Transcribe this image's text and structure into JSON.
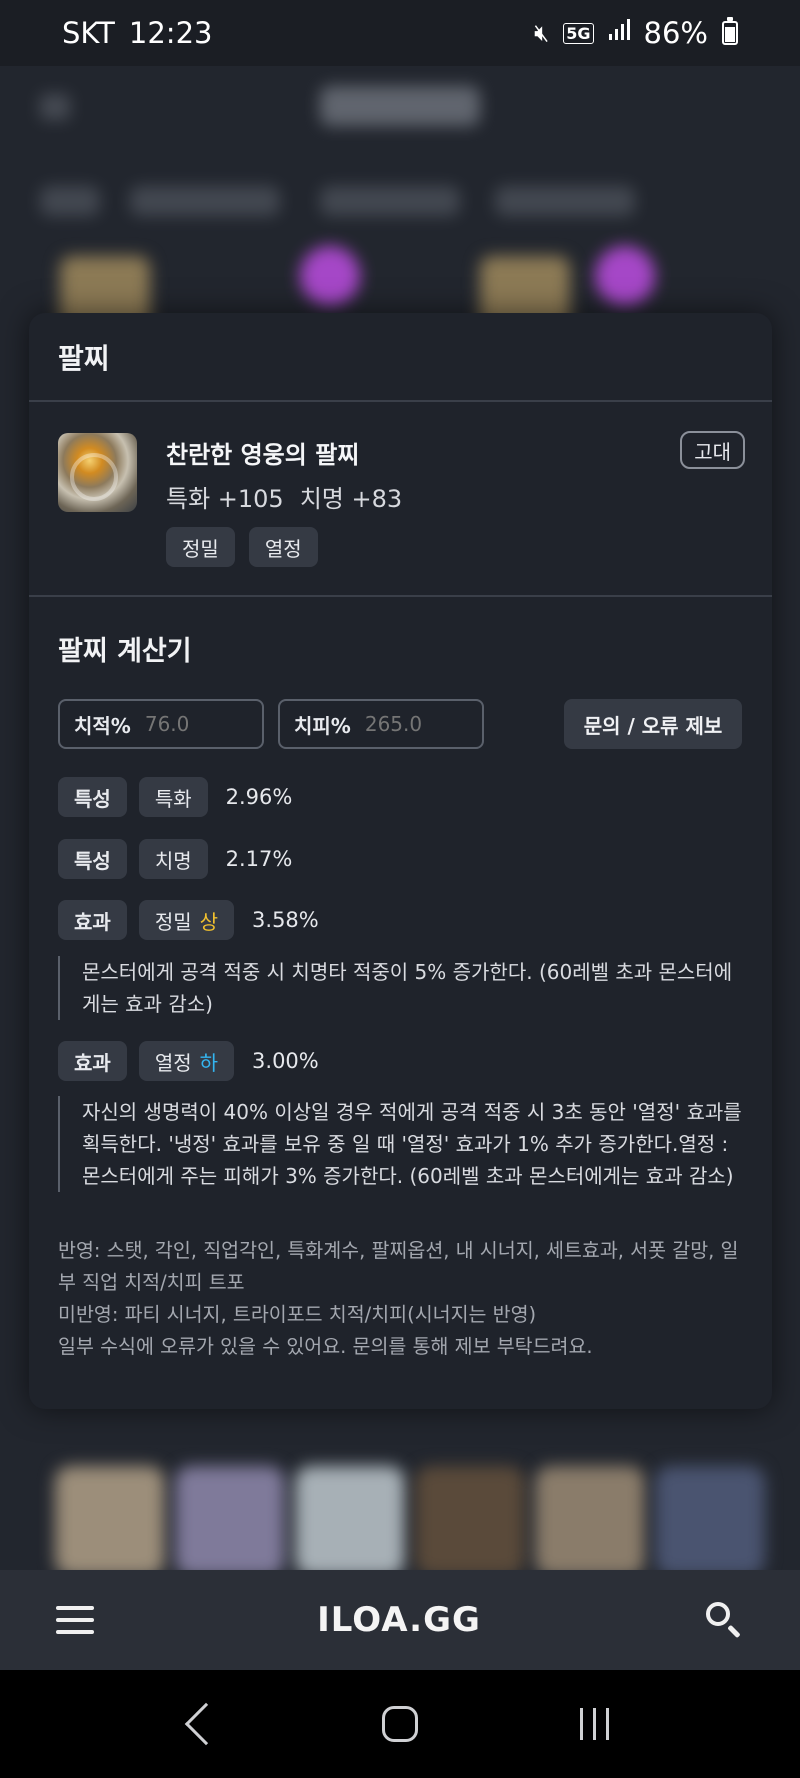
{
  "status_bar": {
    "carrier": "SKT",
    "time": "12:23",
    "network": "5G",
    "battery": "86%"
  },
  "modal": {
    "title": "팔찌",
    "item": {
      "name": "찬란한 영웅의 팔찌",
      "grade": "고대",
      "stats": [
        "특화 +105",
        "치명 +83"
      ],
      "tags": [
        "정밀",
        "열정"
      ]
    },
    "calculator": {
      "title": "팔찌 계산기",
      "crit_rate": {
        "label": "치적%",
        "value": "76.0"
      },
      "crit_dmg": {
        "label": "치피%",
        "value": "265.0"
      },
      "report_button": "문의 / 오류 제보",
      "rows": [
        {
          "type": "특성",
          "name": "특화",
          "grade": "",
          "value": "2.96%"
        },
        {
          "type": "특성",
          "name": "치명",
          "grade": "",
          "value": "2.17%"
        },
        {
          "type": "효과",
          "name": "정밀",
          "grade": "상",
          "value": "3.58%",
          "description": "몬스터에게 공격 적중 시 치명타 적중이 5% 증가한다. (60레벨 초과 몬스터에게는 효과 감소)"
        },
        {
          "type": "효과",
          "name": "열정",
          "grade": "하",
          "value": "3.00%",
          "description": "자신의 생명력이 40% 이상일 경우 적에게 공격 적중 시 3초 동안 '열정' 효과를 획득한다. '냉정' 효과를 보유 중 일 때 '열정' 효과가 1% 추가 증가한다.열정 : 몬스터에게 주는 피해가 3% 증가한다. (60레벨 초과 몬스터에게는 효과 감소)"
        }
      ],
      "notes": [
        "반영: 스탯, 각인, 직업각인, 특화계수, 팔찌옵션, 내 시너지, 세트효과, 서폿 갈망, 일부 직업 치적/치피 트포",
        "미반영: 파티 시너지, 트라이포드 치적/치피(시너지는 반영)",
        "일부 수식에 오류가 있을 수 있어요. 문의를 통해 제보 부탁드려요."
      ]
    }
  },
  "app_bar": {
    "logo": "ILOA.GG",
    "menu_icon": "hamburger-icon",
    "search_icon": "search-icon"
  },
  "colors": {
    "grade_high": "#f2c12e",
    "grade_low": "#34b5f0",
    "modal_bg": "#1f232b"
  }
}
